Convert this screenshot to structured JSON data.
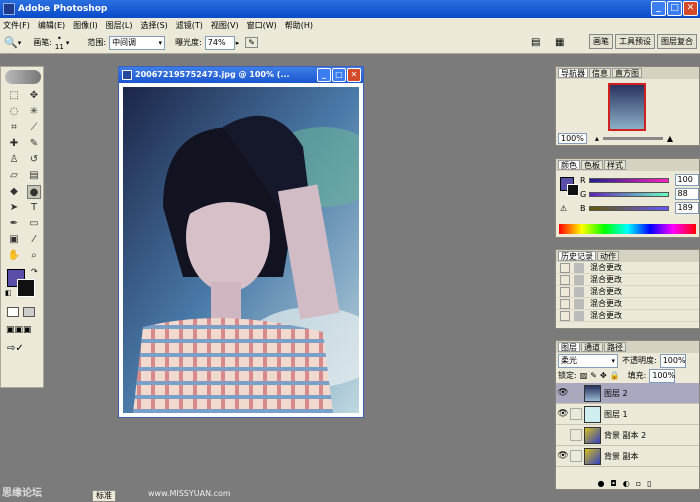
{
  "app": {
    "title": "Adobe Photoshop"
  },
  "menu": [
    "文件(F)",
    "编辑(E)",
    "图像(I)",
    "图层(L)",
    "选择(S)",
    "滤镜(T)",
    "视图(V)",
    "窗口(W)",
    "帮助(H)"
  ],
  "options": {
    "brush_label": "画笔:",
    "brush_size": "11",
    "range_label": "范围:",
    "range_value": "中间调",
    "exposure_label": "曝光度:",
    "exposure_value": "74%",
    "right_tabs": [
      "画笔",
      "工具预设",
      "图层复合"
    ]
  },
  "document": {
    "title": "200672195752473.jpg @ 100% (..."
  },
  "navigator": {
    "tabs": [
      "导航器",
      "信息",
      "直方图"
    ],
    "zoom": "100%"
  },
  "color": {
    "tabs": [
      "颜色",
      "色板",
      "样式"
    ],
    "channels": [
      {
        "label": "R",
        "value": "100",
        "color": "#cc3333"
      },
      {
        "label": "G",
        "value": "88",
        "color": "#33aa33"
      },
      {
        "label": "B",
        "value": "189",
        "color": "#3344cc"
      }
    ]
  },
  "history": {
    "tabs": [
      "历史记录",
      "动作"
    ],
    "items": [
      "混合更改",
      "混合更改",
      "混合更改",
      "混合更改",
      "混合更改"
    ]
  },
  "layers": {
    "tabs": [
      "图层",
      "通道",
      "路径"
    ],
    "blend_mode": "柔光",
    "opacity_label": "不透明度:",
    "opacity_value": "100%",
    "lock_label": "锁定:",
    "fill_label": "填充:",
    "fill_value": "100%",
    "items": [
      "图层 2",
      "图层 1",
      "背景 副本 2",
      "背景 副本"
    ]
  },
  "footer": {
    "site": "思缘论坛",
    "url": "www.MISSYUAN.com",
    "taskbar": "标准"
  }
}
